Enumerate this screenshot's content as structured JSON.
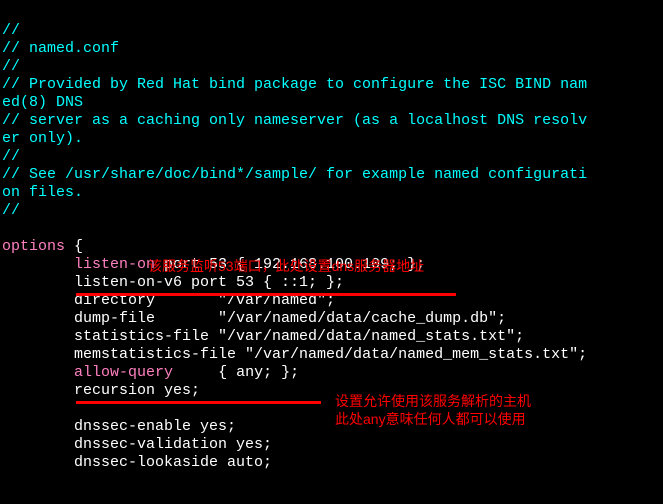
{
  "comments": {
    "l1": "//",
    "l2": "// named.conf",
    "l3": "//",
    "l4a": "// Provided by Red Hat bind package to configure the ISC BIND nam",
    "l4b": "ed(8) DNS",
    "l5a": "// server as a caching only nameserver (as a localhost DNS resolv",
    "l5b": "er only).",
    "l6": "//",
    "l7a": "// See /usr/share/doc/bind*/sample/ for example named configurati",
    "l7b": "on files.",
    "l8": "//"
  },
  "options_kw": "options",
  "brace_open": " {",
  "indent": "        ",
  "listen_on": {
    "kw": "listen-on",
    "rest": " port 53 { 192.168.100.109; };"
  },
  "listen_on_v6": "listen-on-v6 port 53 { ::1; };",
  "directory": {
    "kw": "directory",
    "pad": "       ",
    "val": "\"/var/named\";"
  },
  "dump_file": {
    "kw": "dump-file",
    "pad": "       ",
    "val": "\"/var/named/data/cache_dump.db\";"
  },
  "statistics_file": "statistics-file \"/var/named/data/named_stats.txt\";",
  "memstatistics_file": "memstatistics-file \"/var/named/data/named_mem_stats.txt\";",
  "allow_query": {
    "kw": "allow-query",
    "pad": "     ",
    "val": "{ any; };"
  },
  "recursion": "recursion yes;",
  "dnssec_enable": "dnssec-enable yes;",
  "dnssec_validation": "dnssec-validation yes;",
  "dnssec_lookaside": "dnssec-lookaside auto;",
  "annotations": {
    "top": "该服务监听53端口，此处设置dns服务器地址",
    "bottom1": "设置允许使用该服务解析的主机",
    "bottom2": "此处any意味任何人都可以使用"
  }
}
